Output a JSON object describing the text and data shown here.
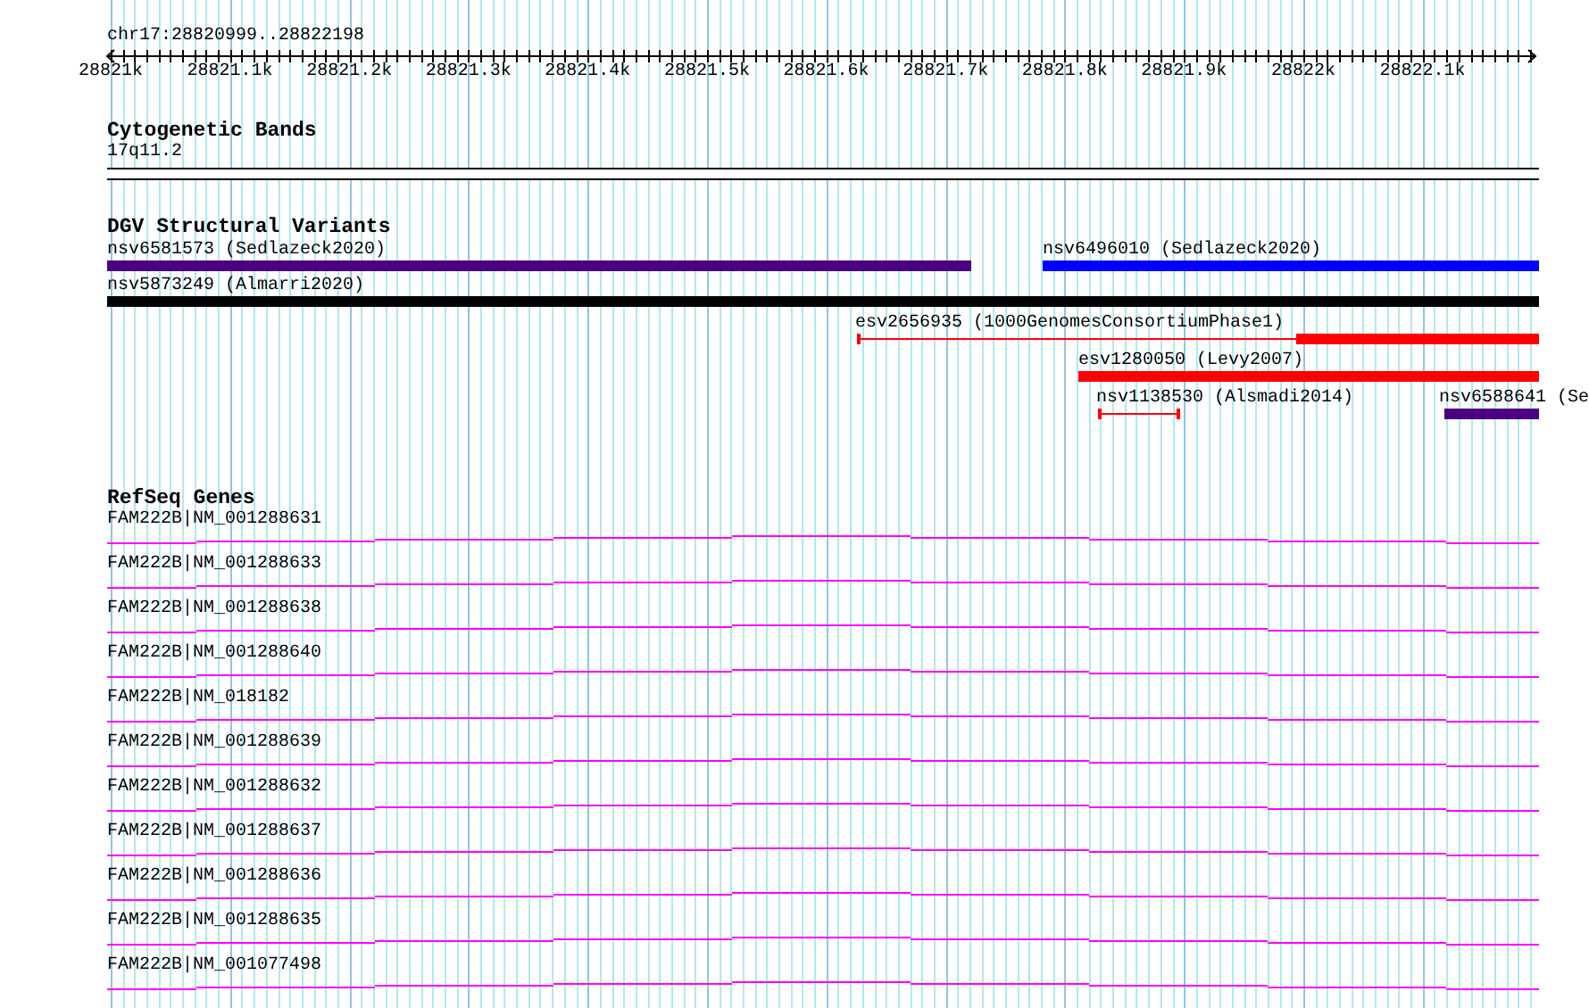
{
  "ruler": {
    "location": "chr17:28820999..28822198",
    "ticks": [
      "28821k",
      "28821.1k",
      "28821.2k",
      "28821.3k",
      "28821.4k",
      "28821.5k",
      "28821.6k",
      "28821.7k",
      "28821.8k",
      "28821.9k",
      "28822k",
      "28822.1k"
    ]
  },
  "tracks": [
    {
      "kind": "bands",
      "title": "Cytogenetic Bands",
      "features": [
        {
          "label": "17q11.2"
        }
      ]
    },
    {
      "kind": "variants",
      "title": "DGV Structural Variants",
      "features": [
        {
          "label": "nsv6581573 (Sedlazeck2020)",
          "kind": "bar",
          "color": "#4b0082"
        },
        {
          "label": "nsv6496010 (Sedlazeck2020)",
          "kind": "bar",
          "color": "#0000ff"
        },
        {
          "label": "nsv5873249 (Almarri2020)",
          "kind": "bar",
          "color": "#000000"
        },
        {
          "label": "esv2656935 (1000GenomesConsortiumPhase1)",
          "kind": "split",
          "color": "#ff0000"
        },
        {
          "label": "esv1280050 (Levy2007)",
          "kind": "bar",
          "color": "#ff0000"
        },
        {
          "label": "nsv1138530 (Alsmadi2014)",
          "kind": "span",
          "color": "#ff0000"
        },
        {
          "label": "nsv6588641 (Se",
          "kind": "bar",
          "color": "#4b0082"
        }
      ]
    },
    {
      "kind": "genes",
      "title": "RefSeq Genes",
      "features": [
        {
          "label": "FAM222B|NM_001288631"
        },
        {
          "label": "FAM222B|NM_001288633"
        },
        {
          "label": "FAM222B|NM_001288638"
        },
        {
          "label": "FAM222B|NM_001288640"
        },
        {
          "label": "FAM222B|NM_018182"
        },
        {
          "label": "FAM222B|NM_001288639"
        },
        {
          "label": "FAM222B|NM_001288632"
        },
        {
          "label": "FAM222B|NM_001288637"
        },
        {
          "label": "FAM222B|NM_001288636"
        },
        {
          "label": "FAM222B|NM_001288635"
        },
        {
          "label": "FAM222B|NM_001077498"
        }
      ]
    }
  ]
}
